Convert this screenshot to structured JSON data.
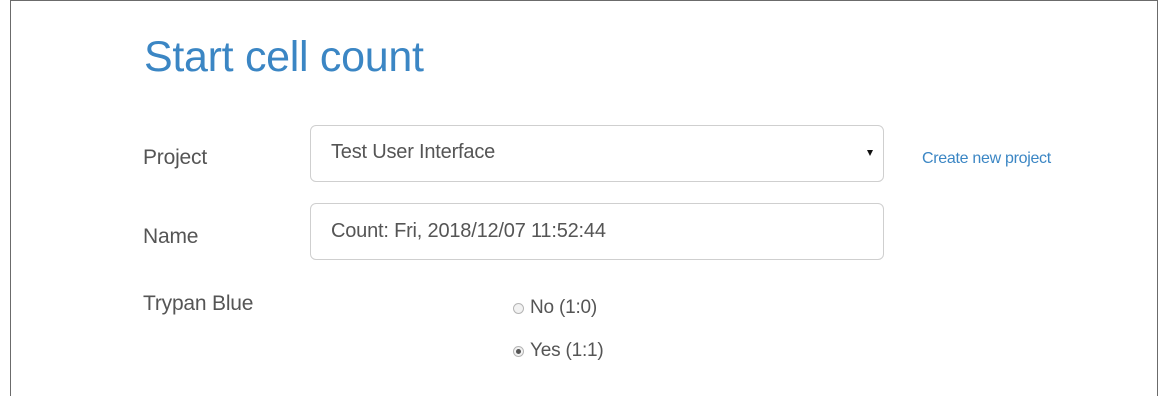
{
  "page": {
    "title": "Start cell count"
  },
  "form": {
    "project": {
      "label": "Project",
      "selected_value": "Test User Interface",
      "create_link": "Create new project"
    },
    "name": {
      "label": "Name",
      "value": "Count: Fri, 2018/12/07 11:52:44"
    },
    "trypan_blue": {
      "label": "Trypan Blue",
      "options": [
        {
          "label": "No (1:0)",
          "checked": false
        },
        {
          "label": "Yes (1:1)",
          "checked": true
        }
      ]
    }
  },
  "colors": {
    "accent": "#3b86c4",
    "text": "#555555",
    "input_border": "#cfcfcf"
  },
  "icons": {
    "select_caret": "caret-down-icon"
  }
}
